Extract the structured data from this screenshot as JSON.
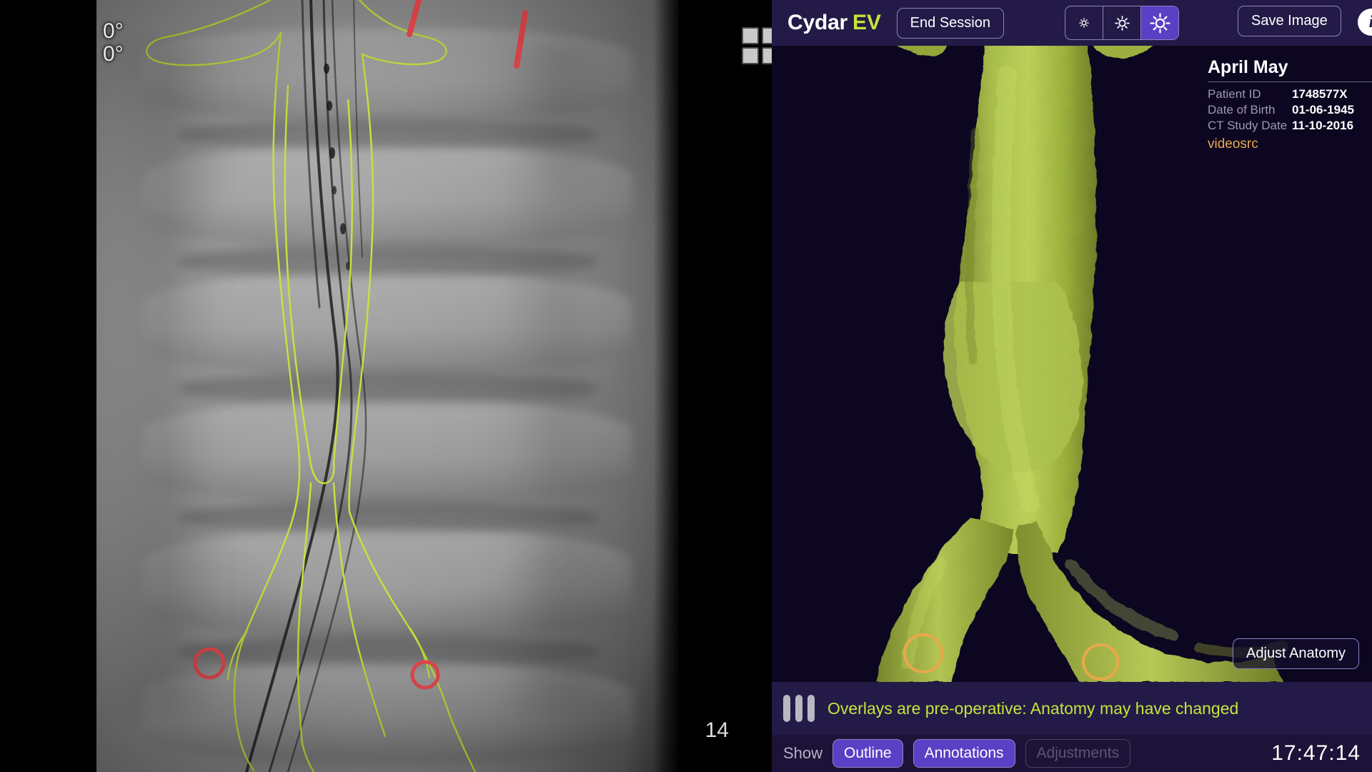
{
  "app": {
    "brand_primary": "Cydar",
    "brand_secondary": "EV"
  },
  "colors": {
    "chrome": "#241a47",
    "accent_purple": "#5b3fc4",
    "lime": "#c3e53c",
    "orange": "#e8a84a",
    "overlay_green": "#c3e53c",
    "marker_red": "#f04a50",
    "aorta_green": "#9aae3c"
  },
  "topbar": {
    "end_session_label": "End Session",
    "save_image_label": "Save Image",
    "info_label": "i",
    "brightness": {
      "options": [
        "low",
        "medium",
        "high"
      ],
      "selected_index": 2
    }
  },
  "patient": {
    "name": "April May",
    "fields": [
      {
        "key": "Patient ID",
        "value": "1748577X"
      },
      {
        "key": "Date of Birth",
        "value": "01-06-1945"
      },
      {
        "key": "CT Study Date",
        "value": "11-10-2016"
      }
    ],
    "source_label": "videosrc"
  },
  "viewport3d": {
    "adjust_anatomy_label": "Adjust Anatomy"
  },
  "warning": {
    "text": "Overlays are pre-operative: Anatomy may have changed"
  },
  "bottom": {
    "show_label": "Show",
    "chips": [
      {
        "label": "Outline",
        "state": "active"
      },
      {
        "label": "Annotations",
        "state": "active"
      },
      {
        "label": "Adjustments",
        "state": "disabled"
      }
    ],
    "clock": "17:47:14"
  },
  "fluoro": {
    "angle_primary": "0°",
    "angle_secondary": "0°",
    "frame_number": "14",
    "grid_icon": "grid-2x2-icon"
  }
}
